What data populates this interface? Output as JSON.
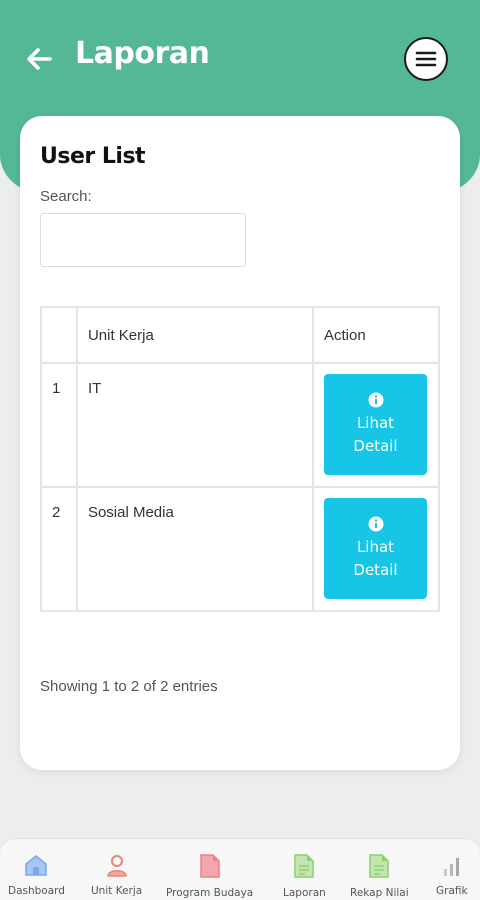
{
  "header": {
    "title": "Laporan",
    "back_icon": "arrow-left-icon",
    "menu_icon": "hamburger-menu-icon",
    "accent_color": "#55b895"
  },
  "card": {
    "title": "User List",
    "search_label": "Search:",
    "search_value": "",
    "table": {
      "columns": [
        "",
        "Unit Kerja",
        "Action"
      ],
      "rows": [
        {
          "no": "1",
          "unit": "IT",
          "action_line1": "Lihat",
          "action_line2": "Detail"
        },
        {
          "no": "2",
          "unit": "Sosial Media",
          "action_line1": "Lihat",
          "action_line2": "Detail"
        }
      ],
      "button_color": "#17c6e6"
    },
    "entries_info": "Showing 1 to 2 of 2 entries"
  },
  "bottom_nav": [
    {
      "label": "Dashboard",
      "icon": "home-icon",
      "color": "#7da7e8"
    },
    {
      "label": "Unit Kerja",
      "icon": "user-icon",
      "color": "#e8857a"
    },
    {
      "label": "Program Budaya",
      "icon": "document-icon",
      "color": "#ef7f8a"
    },
    {
      "label": "Laporan",
      "icon": "document-icon",
      "color": "#8fcf6f"
    },
    {
      "label": "Rekap Nilai",
      "icon": "document-icon",
      "color": "#8fcf6f"
    },
    {
      "label": "Grafik",
      "icon": "bar-chart-icon",
      "color": "#b0b0b0"
    }
  ]
}
